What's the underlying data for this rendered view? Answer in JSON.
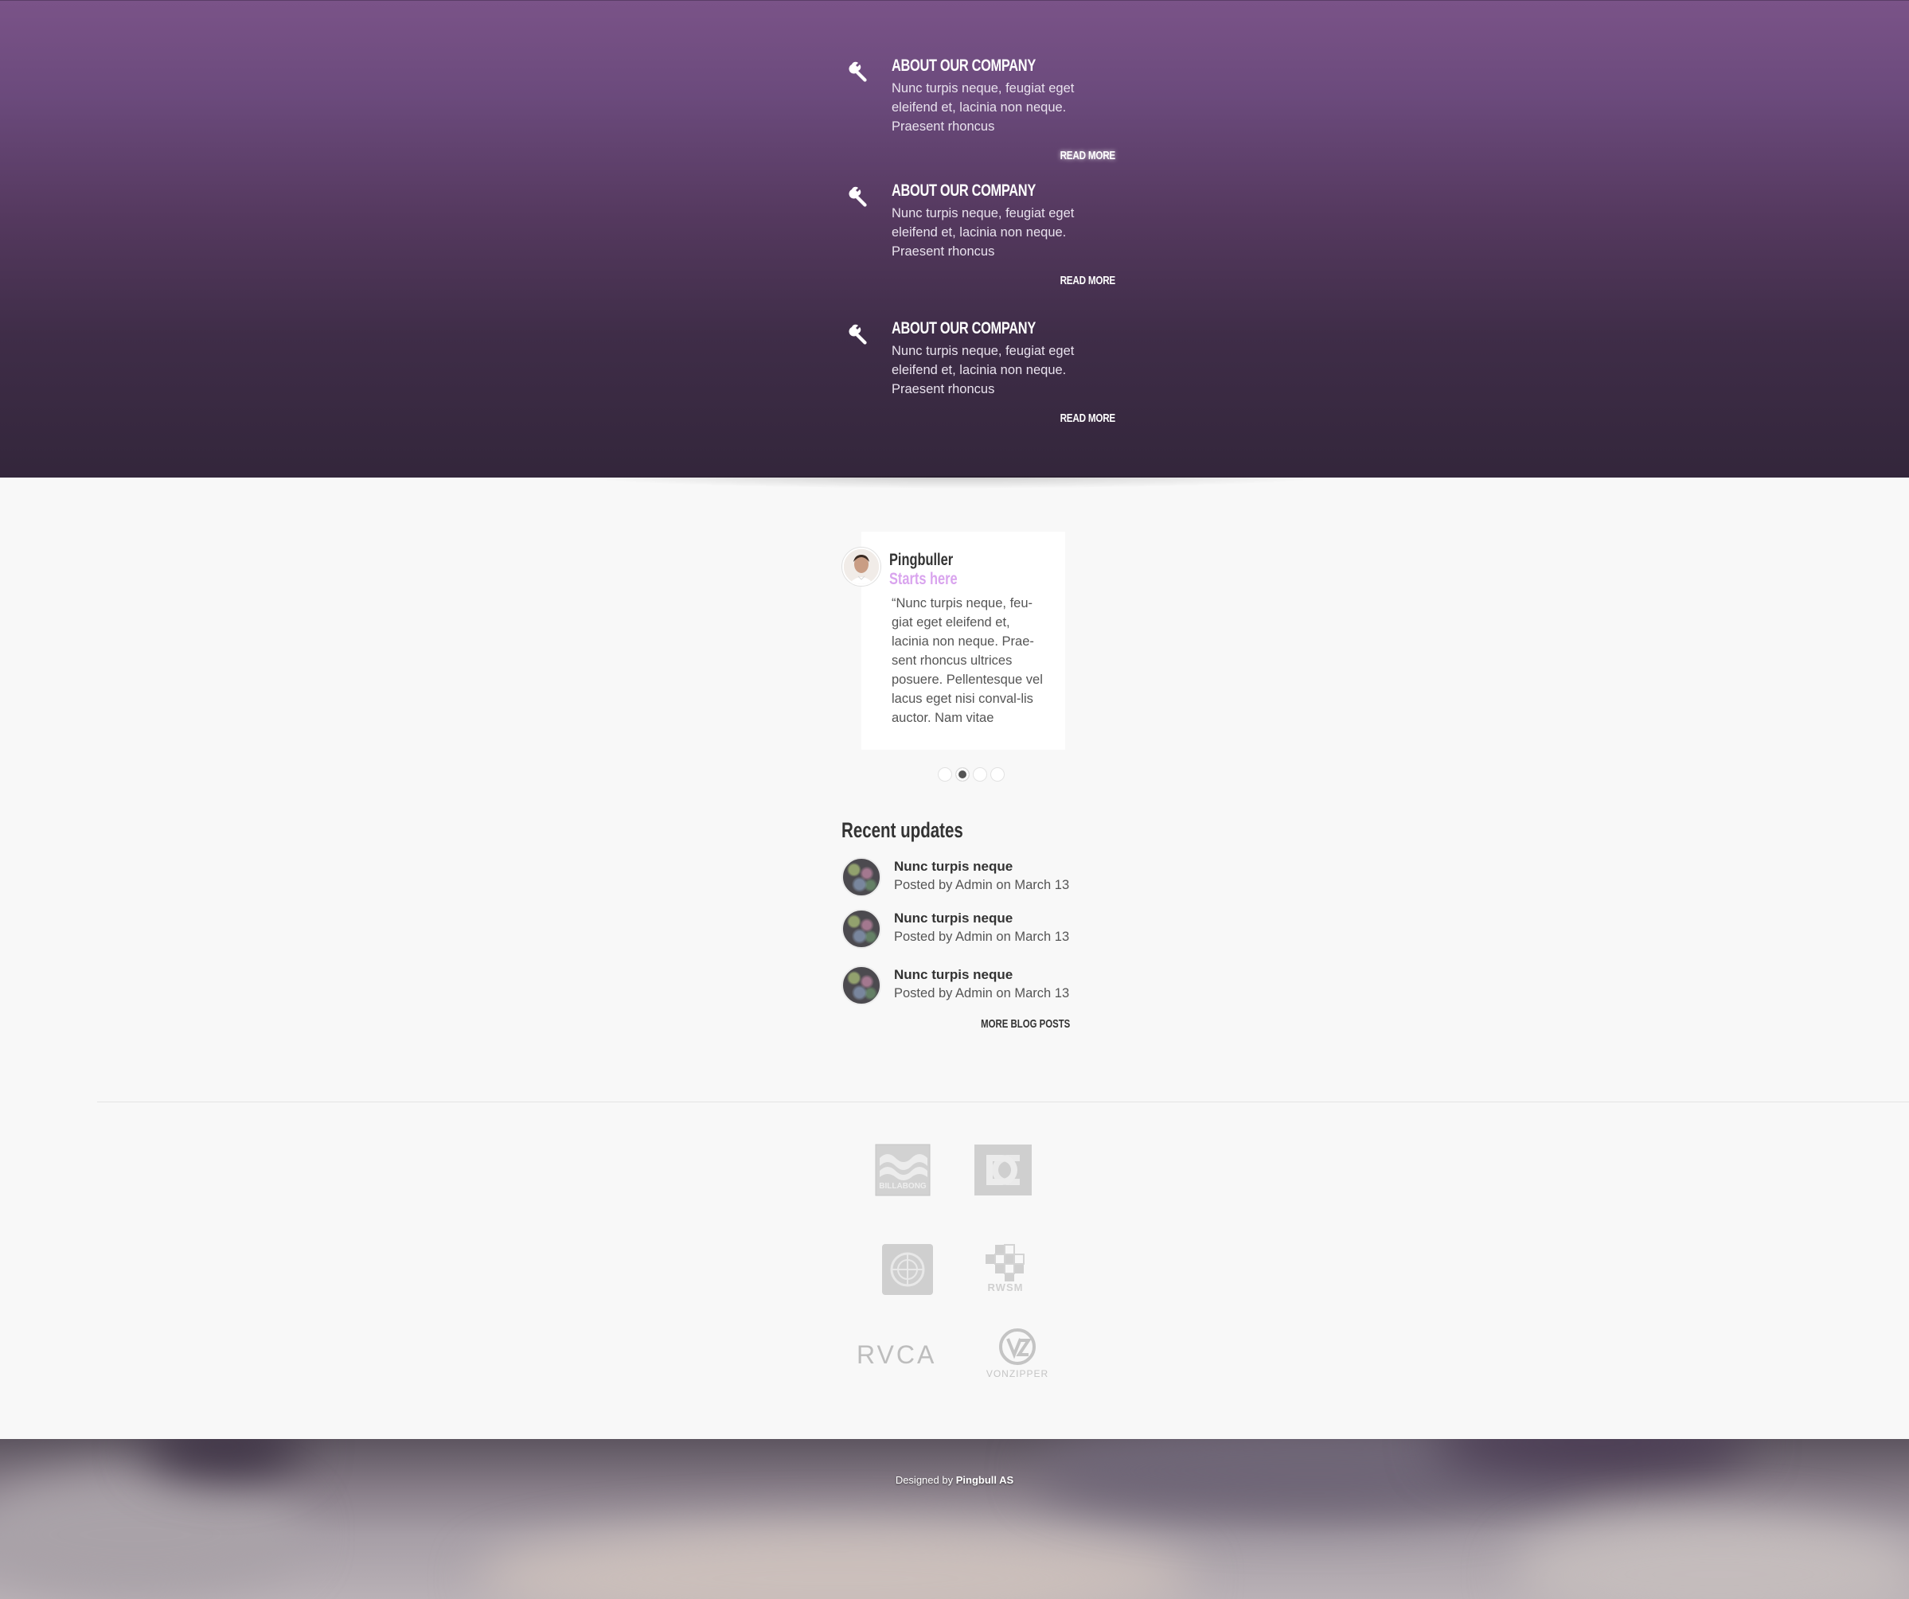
{
  "features": [
    {
      "title": "About our company",
      "text": "Nunc turpis neque, feugiat eget eleifend et, lacinia non neque. Praesent rhoncus",
      "read_more": "Read more",
      "icon": "wrench-icon"
    },
    {
      "title": "About our company",
      "text": "Nunc turpis neque, feugiat eget eleifend et, lacinia non neque. Praesent rhoncus",
      "read_more": "Read more",
      "icon": "wrench-icon"
    },
    {
      "title": "About our company",
      "text": "Nunc turpis neque, feugiat eget eleifend et, lacinia non neque. Praesent rhoncus",
      "read_more": "Read more",
      "icon": "wrench-icon"
    }
  ],
  "testimonial": {
    "name": "Pingbuller",
    "subtitle": "Starts here",
    "quote": "“Nunc turpis neque, feu-giat eget eleifend et, lacinia non neque. Prae-sent rhoncus ultrices posuere. Pellentesque vel lacus eget nisi conval-lis auctor. Nam vitae",
    "slides": 4,
    "active_slide": 2
  },
  "recent_updates": {
    "title": "Recent updates",
    "posts": [
      {
        "title": "Nunc turpis neque",
        "meta": "Posted by Admin on March 13"
      },
      {
        "title": "Nunc turpis neque",
        "meta": "Posted by Admin on March 13"
      },
      {
        "title": "Nunc turpis neque",
        "meta": "Posted by Admin on March 13"
      }
    ],
    "more_label": "More blog posts"
  },
  "brands": {
    "billabong": "BILLABONG",
    "dc": "DC",
    "element": "element",
    "rwsm": "RWSM",
    "rvca": "RVCA",
    "vonzipper": "VONZIPPER"
  },
  "footer": {
    "credit_prefix": "Designed by",
    "credit_name": "Pingbull AS"
  },
  "colors": {
    "hero_top": "#7a5388",
    "hero_bottom": "#33263b",
    "accent": "#d9a4ee",
    "page_bg": "#f8f8f8"
  }
}
